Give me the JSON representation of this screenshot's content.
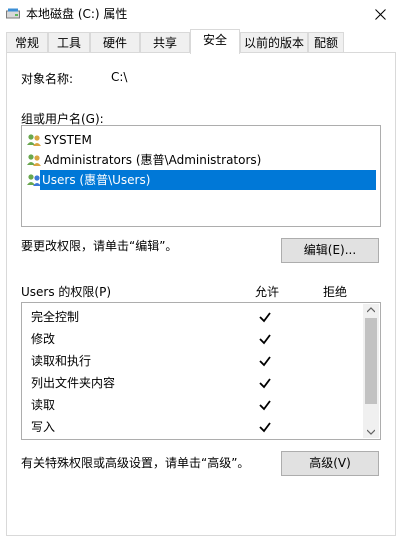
{
  "window": {
    "title": "本地磁盘 (C:) 属性"
  },
  "tabs": [
    {
      "label": "常规"
    },
    {
      "label": "工具"
    },
    {
      "label": "硬件"
    },
    {
      "label": "共享"
    },
    {
      "label": "安全"
    },
    {
      "label": "以前的版本"
    },
    {
      "label": "配额"
    }
  ],
  "security": {
    "object_label": "对象名称:",
    "object_value": "C:\\",
    "groups_label": "组或用户名(G):",
    "users": [
      {
        "name": "SYSTEM"
      },
      {
        "name": "Administrators (惠普\\Administrators)"
      },
      {
        "name": "Users (惠普\\Users)"
      }
    ],
    "change_hint": "要更改权限，请单击“编辑”。",
    "edit_button": "编辑(E)...",
    "perm_header": "Users 的权限(P)",
    "allow_header": "允许",
    "deny_header": "拒绝",
    "permissions": [
      {
        "name": "完全控制",
        "allow": true
      },
      {
        "name": "修改",
        "allow": true
      },
      {
        "name": "读取和执行",
        "allow": true
      },
      {
        "name": "列出文件夹内容",
        "allow": true
      },
      {
        "name": "读取",
        "allow": true
      },
      {
        "name": "写入",
        "allow": true
      }
    ],
    "advanced_hint": "有关特殊权限或高级设置，请单击“高级”。",
    "advanced_button": "高级(V)"
  }
}
